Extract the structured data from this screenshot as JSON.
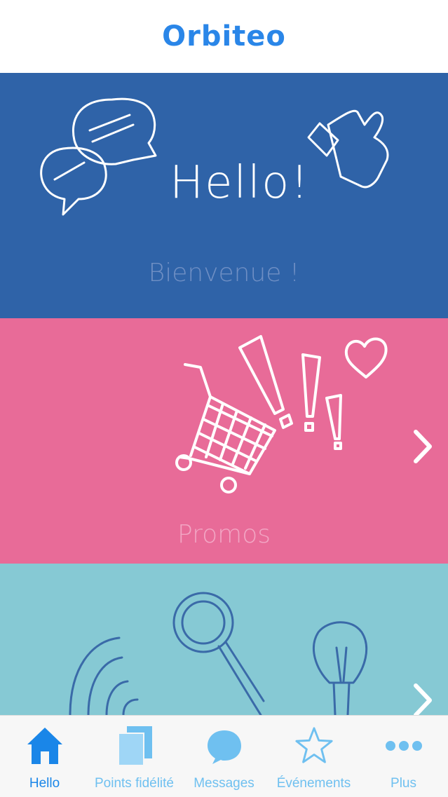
{
  "header": {
    "logo_text": "Orbiteo"
  },
  "panels": {
    "hello": {
      "headline": "Hello!",
      "label": "Bienvenue !"
    },
    "promos": {
      "label": "Promos"
    }
  },
  "tabbar": {
    "tabs": [
      {
        "label": "Hello",
        "icon": "home-icon",
        "active": true
      },
      {
        "label": "Points fidélité",
        "icon": "cards-icon",
        "active": false
      },
      {
        "label": "Messages",
        "icon": "speech-bubble-icon",
        "active": false
      },
      {
        "label": "Événements",
        "icon": "star-icon",
        "active": false
      },
      {
        "label": "Plus",
        "icon": "more-dots-icon",
        "active": false
      }
    ]
  },
  "colors": {
    "brand": "#2a86e8",
    "hello_bg": "#2f63a8",
    "promos_bg": "#e86b98",
    "third_bg": "#86c9d4",
    "tab_active": "#1a86e8",
    "tab_inactive": "#6fc0f0"
  }
}
